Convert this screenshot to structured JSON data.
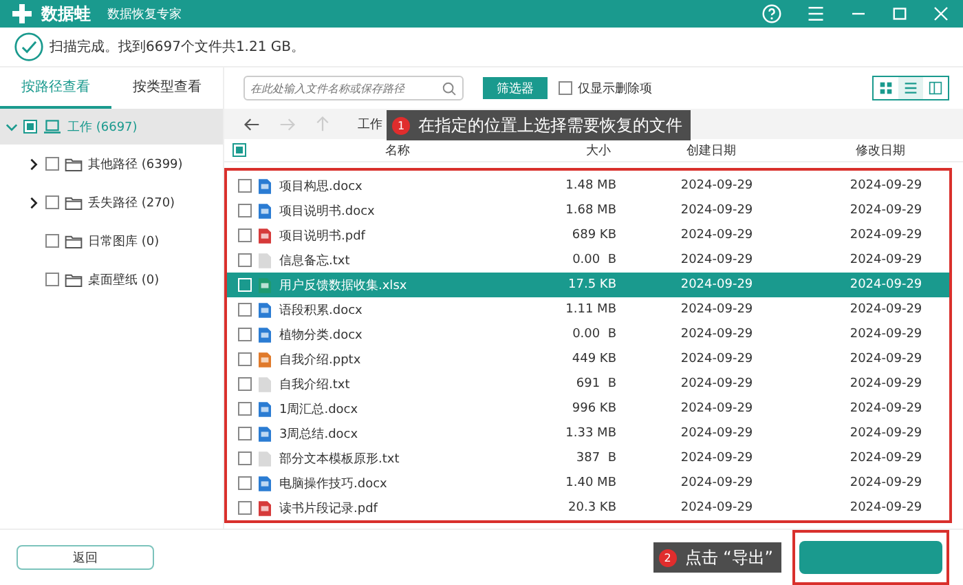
{
  "app": {
    "name": "数据蛙",
    "subtitle": "数据恢复专家"
  },
  "scan_status": "扫描完成。找到6697个文件共1.21 GB。",
  "view_tabs": [
    {
      "label": "按路径查看",
      "selected": true
    },
    {
      "label": "按类型查看",
      "selected": false
    }
  ],
  "tree": [
    {
      "label": "工作 (6697)",
      "kind": "drive",
      "checked": false,
      "indeterminate": true,
      "expanded": true,
      "selected": true,
      "children": [
        {
          "label": "其他路径 (6399)",
          "kind": "folder",
          "checked": false,
          "expanded": false,
          "selected": false
        },
        {
          "label": "丢失路径 (270)",
          "kind": "folder",
          "checked": false,
          "expanded": false,
          "selected": false
        },
        {
          "label": "日常图库 (0)",
          "kind": "folder",
          "checked": false,
          "selected": false
        },
        {
          "label": "桌面壁纸 (0)",
          "kind": "folder",
          "checked": false,
          "selected": false
        }
      ]
    }
  ],
  "search": {
    "placeholder": "在此处输入文件名称或保存路径"
  },
  "filter_button": "筛选器",
  "deleted_only": {
    "label": "仅显示删除项",
    "checked": false
  },
  "view_modes": [
    {
      "kind": "grid",
      "selected": false
    },
    {
      "kind": "list",
      "selected": true
    },
    {
      "kind": "columns",
      "selected": false
    }
  ],
  "breadcrumb": {
    "back_disabled": false,
    "forward_disabled": true,
    "up_disabled": true,
    "path": "工作"
  },
  "table": {
    "select_all": {
      "checked": false,
      "indeterminate": true
    },
    "columns": [
      "名称",
      "大小",
      "创建日期",
      "修改日期"
    ],
    "rows": [
      {
        "kind": "docx",
        "name": "项目构思.docx",
        "size": "1.48 MB",
        "created": "2024-09-29",
        "modified": "2024-09-29",
        "selected": false
      },
      {
        "kind": "docx",
        "name": "项目说明书.docx",
        "size": "1.68 MB",
        "created": "2024-09-29",
        "modified": "2024-09-29",
        "selected": false
      },
      {
        "kind": "pdf",
        "name": "项目说明书.pdf",
        "size": "689 KB",
        "created": "2024-09-29",
        "modified": "2024-09-29",
        "selected": false
      },
      {
        "kind": "txt",
        "name": "信息备忘.txt",
        "size": "0.00  B",
        "created": "2024-09-29",
        "modified": "2024-09-29",
        "selected": false
      },
      {
        "kind": "xlsx",
        "name": "用户反馈数据收集.xlsx",
        "size": "17.5 KB",
        "created": "2024-09-29",
        "modified": "2024-09-29",
        "selected": true
      },
      {
        "kind": "docx",
        "name": "语段积累.docx",
        "size": "1.11 MB",
        "created": "2024-09-29",
        "modified": "2024-09-29",
        "selected": false
      },
      {
        "kind": "docx",
        "name": "植物分类.docx",
        "size": "0.00  B",
        "created": "2024-09-29",
        "modified": "2024-09-29",
        "selected": false
      },
      {
        "kind": "pptx",
        "name": "自我介绍.pptx",
        "size": "449 KB",
        "created": "2024-09-29",
        "modified": "2024-09-29",
        "selected": false
      },
      {
        "kind": "txt",
        "name": "自我介绍.txt",
        "size": "691  B",
        "created": "2024-09-29",
        "modified": "2024-09-29",
        "selected": false
      },
      {
        "kind": "docx",
        "name": "1周汇总.docx",
        "size": "996 KB",
        "created": "2024-09-29",
        "modified": "2024-09-29",
        "selected": false
      },
      {
        "kind": "docx",
        "name": "3周总结.docx",
        "size": "1.33 MB",
        "created": "2024-09-29",
        "modified": "2024-09-29",
        "selected": false
      },
      {
        "kind": "txt",
        "name": "部分文本模板原形.txt",
        "size": "387  B",
        "created": "2024-09-29",
        "modified": "2024-09-29",
        "selected": false
      },
      {
        "kind": "docx",
        "name": "电脑操作技巧.docx",
        "size": "1.40 MB",
        "created": "2024-09-29",
        "modified": "2024-09-29",
        "selected": false
      },
      {
        "kind": "pdf",
        "name": "读书片段记录.pdf",
        "size": "20.3 KB",
        "created": "2024-09-29",
        "modified": "2024-09-29",
        "selected": false
      }
    ]
  },
  "callouts": [
    {
      "number": "1",
      "text": "在指定的位置上选择需要恢复的文件"
    },
    {
      "number": "2",
      "text": "点击 “导出”"
    }
  ],
  "back_button": "返回"
}
